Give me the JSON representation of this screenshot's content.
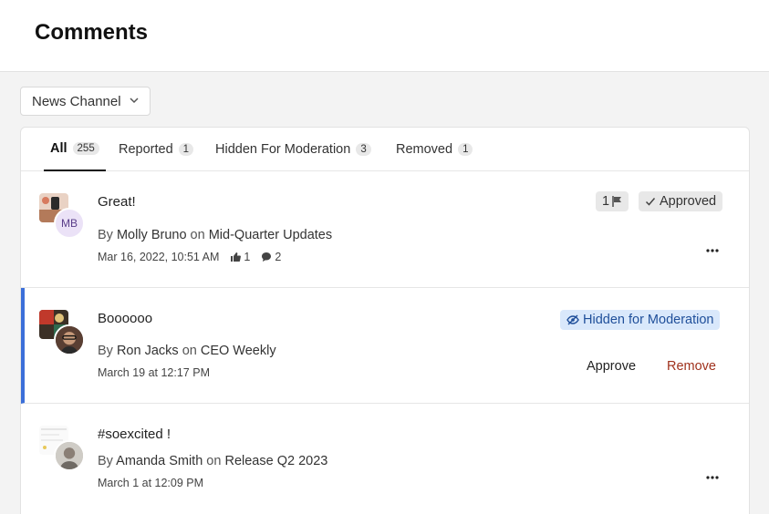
{
  "page": {
    "title": "Comments"
  },
  "filter": {
    "channel_label": "News Channel"
  },
  "tabs": [
    {
      "label": "All",
      "count": "255"
    },
    {
      "label": "Reported",
      "count": "1"
    },
    {
      "label": "Hidden For Moderation",
      "count": "3"
    },
    {
      "label": "Removed",
      "count": "1"
    }
  ],
  "comments": [
    {
      "text": "Great!",
      "by": "By",
      "author": "Molly Bruno",
      "on": "on",
      "post": "Mid-Quarter Updates",
      "date": "Mar 16, 2022, 10:51 AM",
      "likes": "1",
      "replies": "2",
      "initials": "MB",
      "flag_count": "1",
      "status": "Approved"
    },
    {
      "text": "Boooooo",
      "by": "By",
      "author": "Ron Jacks",
      "on": "on",
      "post": "CEO Weekly",
      "date": "March 19 at 12:17 PM",
      "status": "Hidden for Moderation",
      "approve_label": "Approve",
      "remove_label": "Remove"
    },
    {
      "text": "#soexcited !",
      "by": "By",
      "author": "Amanda Smith",
      "on": "on",
      "post": "Release Q2 2023",
      "date": "March 1 at 12:09 PM"
    }
  ],
  "colors": {
    "accent": "#3b6fd9",
    "remove": "#a0321d",
    "hidden_badge_bg": "#d9e8fb",
    "hidden_badge_text": "#1f4f9a"
  }
}
